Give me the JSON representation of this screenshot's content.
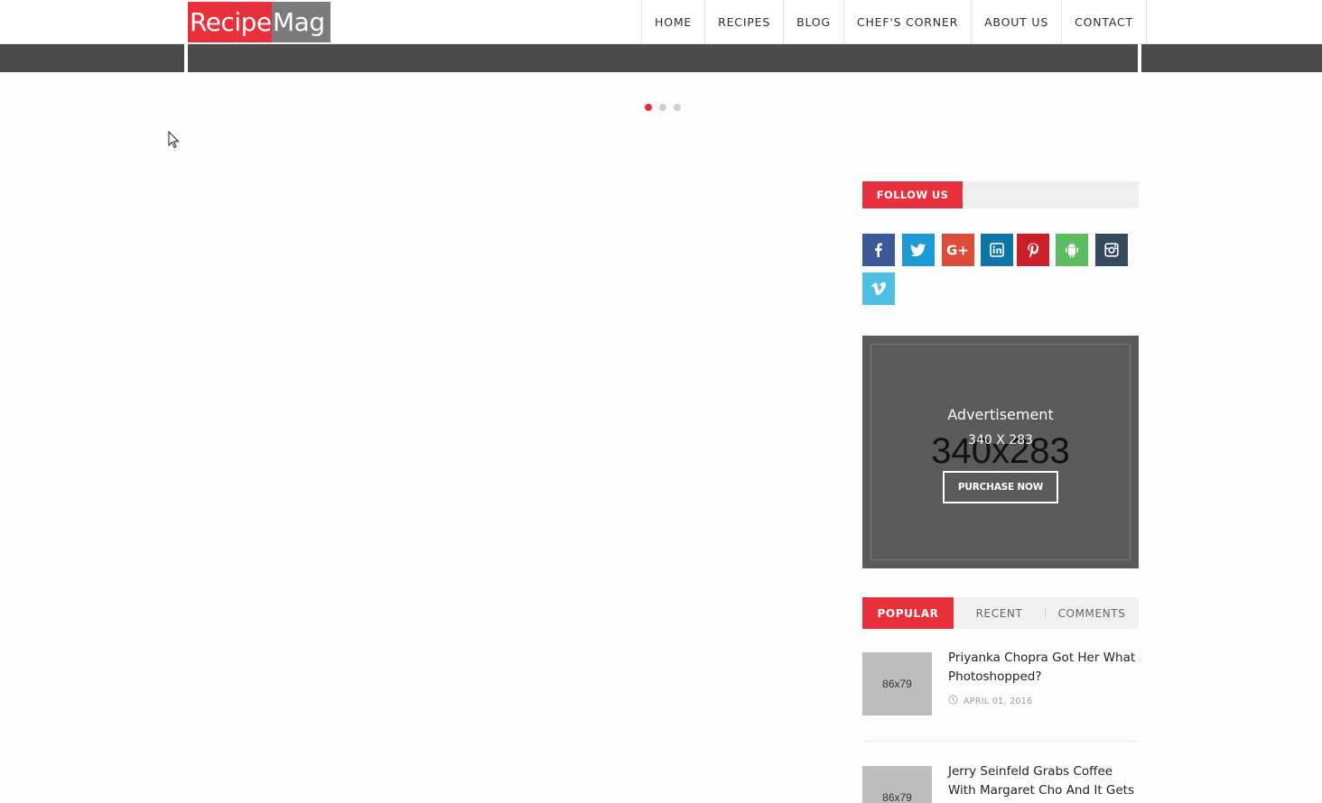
{
  "logo": {
    "part1": "Recipe",
    "part2": "Mag"
  },
  "nav": {
    "items": [
      {
        "label": "HOME"
      },
      {
        "label": "RECIPES"
      },
      {
        "label": "BLOG"
      },
      {
        "label": "CHEF'S CORNER"
      },
      {
        "label": "ABOUT US"
      },
      {
        "label": "CONTACT"
      }
    ]
  },
  "slider": {
    "dot_count": 3,
    "active_index": 0
  },
  "follow": {
    "title": "FOLLOW US",
    "icons": [
      {
        "name": "facebook-icon",
        "color": "#3b5998"
      },
      {
        "name": "twitter-icon",
        "color": "#1c9ad6"
      },
      {
        "name": "google-plus-icon",
        "color": "#dd4b39"
      },
      {
        "name": "linkedin-icon",
        "color": "#0e76a8"
      },
      {
        "name": "pinterest-icon",
        "color": "#cb2027"
      },
      {
        "name": "android-icon",
        "color": "#5bbd60"
      },
      {
        "name": "instagram-icon",
        "color": "#34495e"
      },
      {
        "name": "vimeo-icon",
        "color": "#4ebee3"
      }
    ]
  },
  "ad": {
    "title": "Advertisement",
    "placeholder": "340x283",
    "size": "340 X 283",
    "button": "PURCHASE NOW"
  },
  "tabs": {
    "items": [
      {
        "label": "POPULAR",
        "active": true
      },
      {
        "label": "RECENT",
        "active": false
      },
      {
        "label": "COMMENTS",
        "active": false
      }
    ]
  },
  "posts": [
    {
      "thumb": "86x79",
      "title": "Priyanka Chopra Got Her What Photoshopped?",
      "date": "APRIL 01, 2016"
    },
    {
      "thumb": "86x79",
      "title": "Jerry Seinfeld Grabs Coffee With Margaret Cho And It Gets"
    }
  ],
  "colors": {
    "accent": "#e8303c",
    "band": "#4a4a4a"
  }
}
